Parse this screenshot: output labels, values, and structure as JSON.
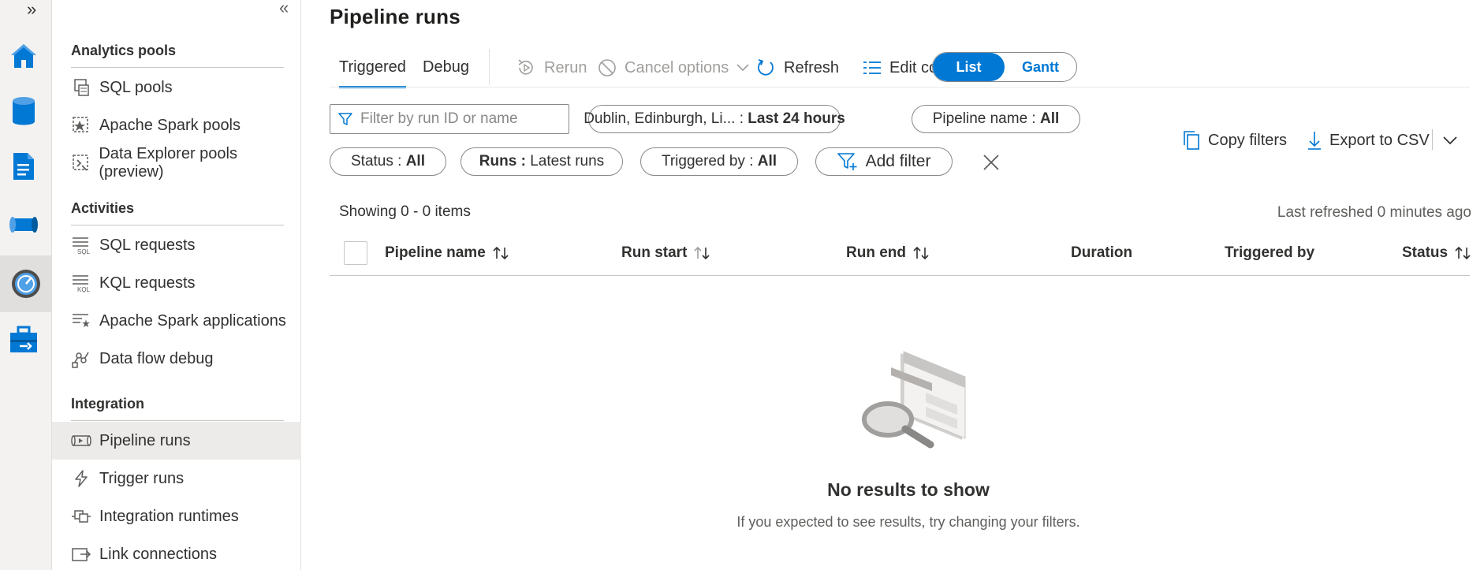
{
  "rail": {
    "expand_label": "»",
    "icons": [
      "home-icon",
      "database-icon",
      "document-icon",
      "pipeline-icon",
      "monitor-icon",
      "toolbox-icon"
    ],
    "accent": "#0078d4"
  },
  "nav": {
    "collapse_label": "«",
    "sections": {
      "analytics": "Analytics pools",
      "activities": "Activities",
      "integration": "Integration"
    },
    "items": {
      "sql_pools": "SQL pools",
      "spark_pools": "Apache Spark pools",
      "dx_pools": "Data Explorer pools (preview)",
      "sql_requests": "SQL requests",
      "kql_requests": "KQL requests",
      "spark_apps": "Apache Spark applications",
      "dataflow_debug": "Data flow debug",
      "pipeline_runs": "Pipeline runs",
      "trigger_runs": "Trigger runs",
      "integration_runtimes": "Integration runtimes",
      "link_connections": "Link connections"
    },
    "selected": "pipeline_runs"
  },
  "page": {
    "title": "Pipeline runs"
  },
  "toolbar": {
    "tab_triggered": "Triggered",
    "tab_debug": "Debug",
    "rerun": "Rerun",
    "cancel_options": "Cancel options",
    "refresh": "Refresh",
    "edit_columns": "Edit columns",
    "view_list": "List",
    "view_gantt": "Gantt",
    "active_view": "List",
    "active_tab": "Triggered"
  },
  "filters": {
    "search_placeholder": "Filter by run ID or name",
    "timezone_label": "Dublin, Edinburgh, Li...",
    "timezone_sep": " : ",
    "timezone_value": "Last 24 hours",
    "pipeline_name_label": "Pipeline name : ",
    "pipeline_name_value": "All",
    "status_label": "Status : ",
    "status_value": "All",
    "runs_label": "Runs : ",
    "runs_value": "Latest runs",
    "triggered_by_label": "Triggered by : ",
    "triggered_by_value": "All",
    "add_filter": "Add filter",
    "copy_filters": "Copy filters",
    "export_csv": "Export to CSV"
  },
  "results": {
    "showing": "Showing 0 - 0 items",
    "last_refreshed": "Last refreshed 0 minutes ago",
    "columns": {
      "pipeline_name": "Pipeline name",
      "run_start": "Run start",
      "run_end": "Run end",
      "duration": "Duration",
      "triggered_by": "Triggered by",
      "status": "Status"
    },
    "rows": [],
    "empty_title": "No results to show",
    "empty_subtitle": "If you expected to see results, try changing your filters."
  }
}
